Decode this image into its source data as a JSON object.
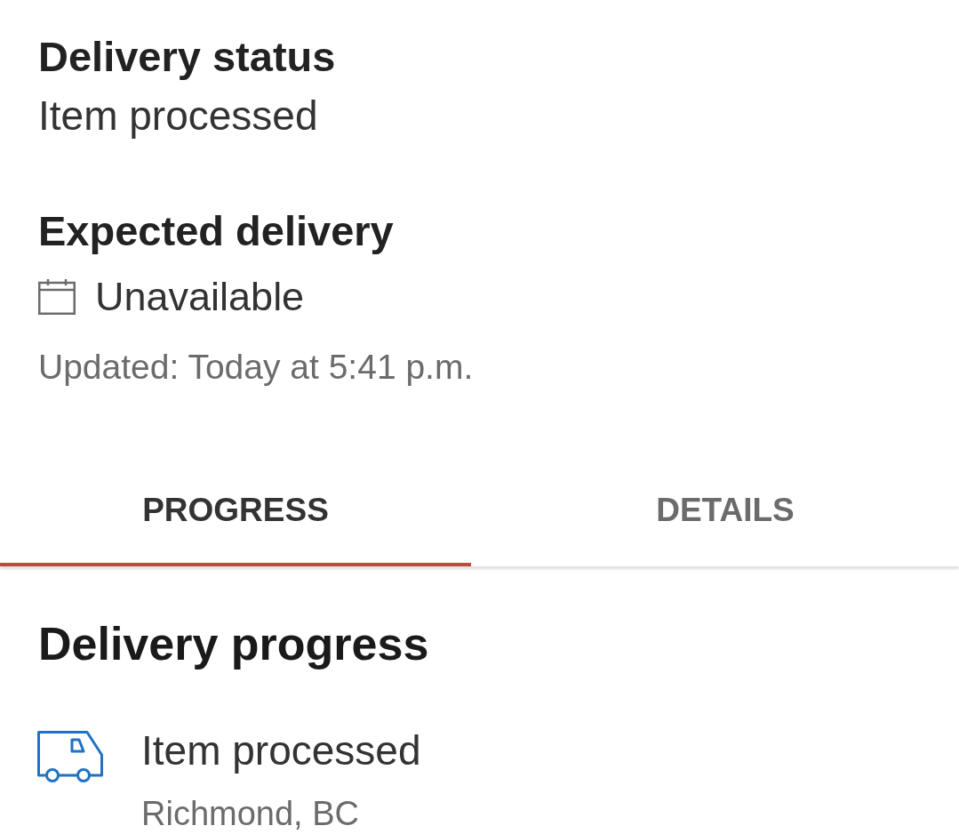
{
  "status": {
    "label": "Delivery status",
    "value": "Item processed"
  },
  "expected_delivery": {
    "label": "Expected delivery",
    "value": "Unavailable",
    "updated": "Updated: Today at 5:41 p.m."
  },
  "tabs": [
    {
      "label": "PROGRESS",
      "selected": true
    },
    {
      "label": "DETAILS",
      "selected": false
    }
  ],
  "progress": {
    "title": "Delivery progress",
    "events": [
      {
        "title": "Item processed",
        "location": "Richmond, BC"
      }
    ]
  }
}
